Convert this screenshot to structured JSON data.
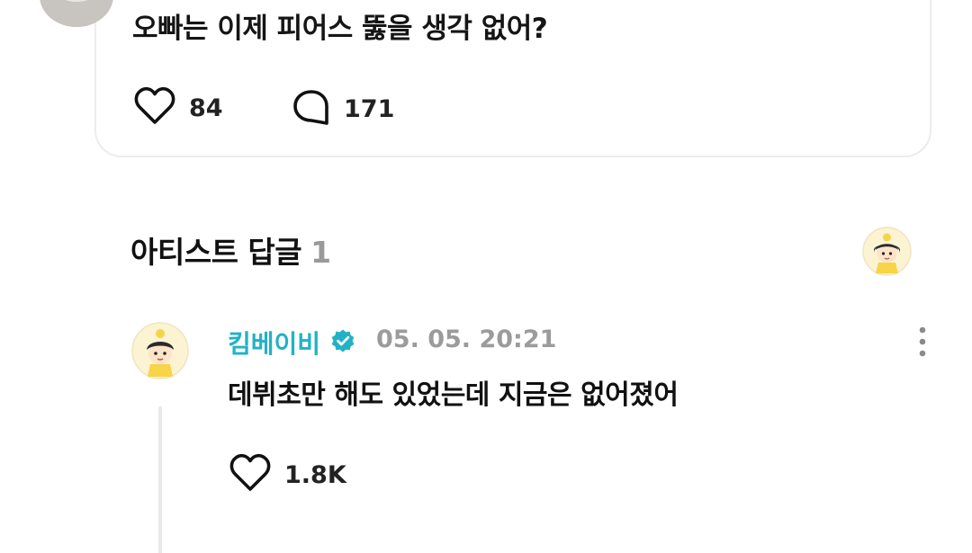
{
  "post": {
    "text": "오빠는 이제 피어스 뚫을 생각 없어?",
    "likes": "84",
    "comments": "171"
  },
  "artist_replies": {
    "title": "아티스트 답글",
    "count": "1"
  },
  "reply": {
    "author": "킴베이비",
    "timestamp": "05. 05. 20:21",
    "text": "데뷔초만 해도 있었는데 지금은 없어졌어",
    "likes": "1.8K"
  },
  "colors": {
    "accent": "#21b2c6",
    "muted": "#9b9b9b",
    "border": "#ececec"
  }
}
